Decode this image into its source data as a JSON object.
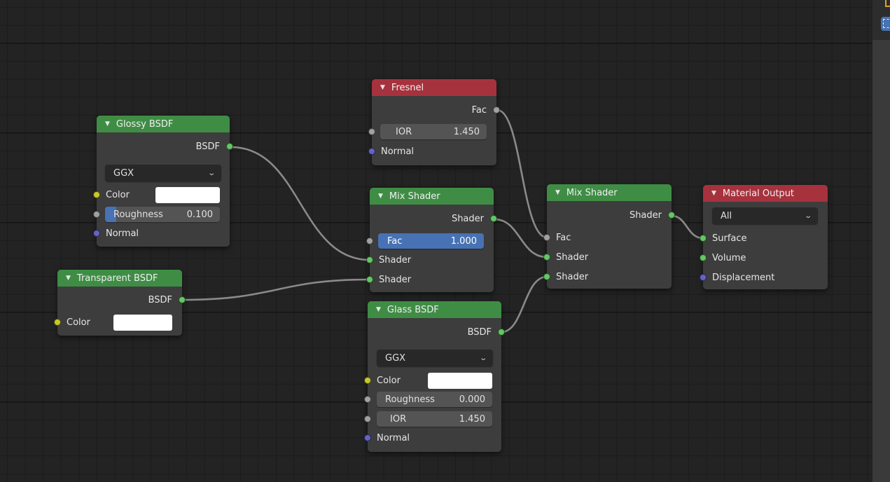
{
  "editor": "Shader Editor",
  "socket_colors": {
    "shader": "#63c763",
    "color": "#c7c729",
    "float": "#a1a1a1",
    "vector": "#6363c7"
  },
  "header_colors": {
    "shader_node": "#3f8d45",
    "input_output_node": "#a6323d"
  },
  "nodes": {
    "glossy": {
      "title": "Glossy BSDF",
      "output": "BSDF",
      "distribution": "GGX",
      "color_label": "Color",
      "color_value": "#ffffff",
      "roughness_label": "Roughness",
      "roughness_value": "0.100",
      "roughness_fraction": 0.1,
      "normal_label": "Normal"
    },
    "transparent": {
      "title": "Transparent BSDF",
      "output": "BSDF",
      "color_label": "Color",
      "color_value": "#ffffff"
    },
    "fresnel": {
      "title": "Fresnel",
      "output": "Fac",
      "ior_label": "IOR",
      "ior_value": "1.450",
      "normal_label": "Normal"
    },
    "mix1": {
      "title": "Mix Shader",
      "output": "Shader",
      "fac_label": "Fac",
      "fac_value": "1.000",
      "fac_fraction": 1.0,
      "shader1_label": "Shader",
      "shader2_label": "Shader"
    },
    "glass": {
      "title": "Glass BSDF",
      "output": "BSDF",
      "distribution": "GGX",
      "color_label": "Color",
      "color_value": "#ffffff",
      "roughness_label": "Roughness",
      "roughness_value": "0.000",
      "ior_label": "IOR",
      "ior_value": "1.450",
      "normal_label": "Normal"
    },
    "mix2": {
      "title": "Mix Shader",
      "output": "Shader",
      "fac_label": "Fac",
      "shader1_label": "Shader",
      "shader2_label": "Shader"
    },
    "output": {
      "title": "Material Output",
      "target": "All",
      "surface_label": "Surface",
      "volume_label": "Volume",
      "displacement_label": "Displacement"
    }
  },
  "links": [
    {
      "from": "Glossy BSDF.BSDF",
      "to": "Mix Shader.Shader (1)"
    },
    {
      "from": "Transparent BSDF.BSDF",
      "to": "Mix Shader.Shader (2)"
    },
    {
      "from": "Fresnel.Fac",
      "to": "Mix Shader 2.Fac"
    },
    {
      "from": "Mix Shader.Shader",
      "to": "Mix Shader 2.Shader (1)"
    },
    {
      "from": "Glass BSDF.BSDF",
      "to": "Mix Shader 2.Shader (2)"
    },
    {
      "from": "Mix Shader 2.Shader",
      "to": "Material Output.Surface"
    }
  ],
  "toolbar": {
    "active_tool": "select-box"
  }
}
